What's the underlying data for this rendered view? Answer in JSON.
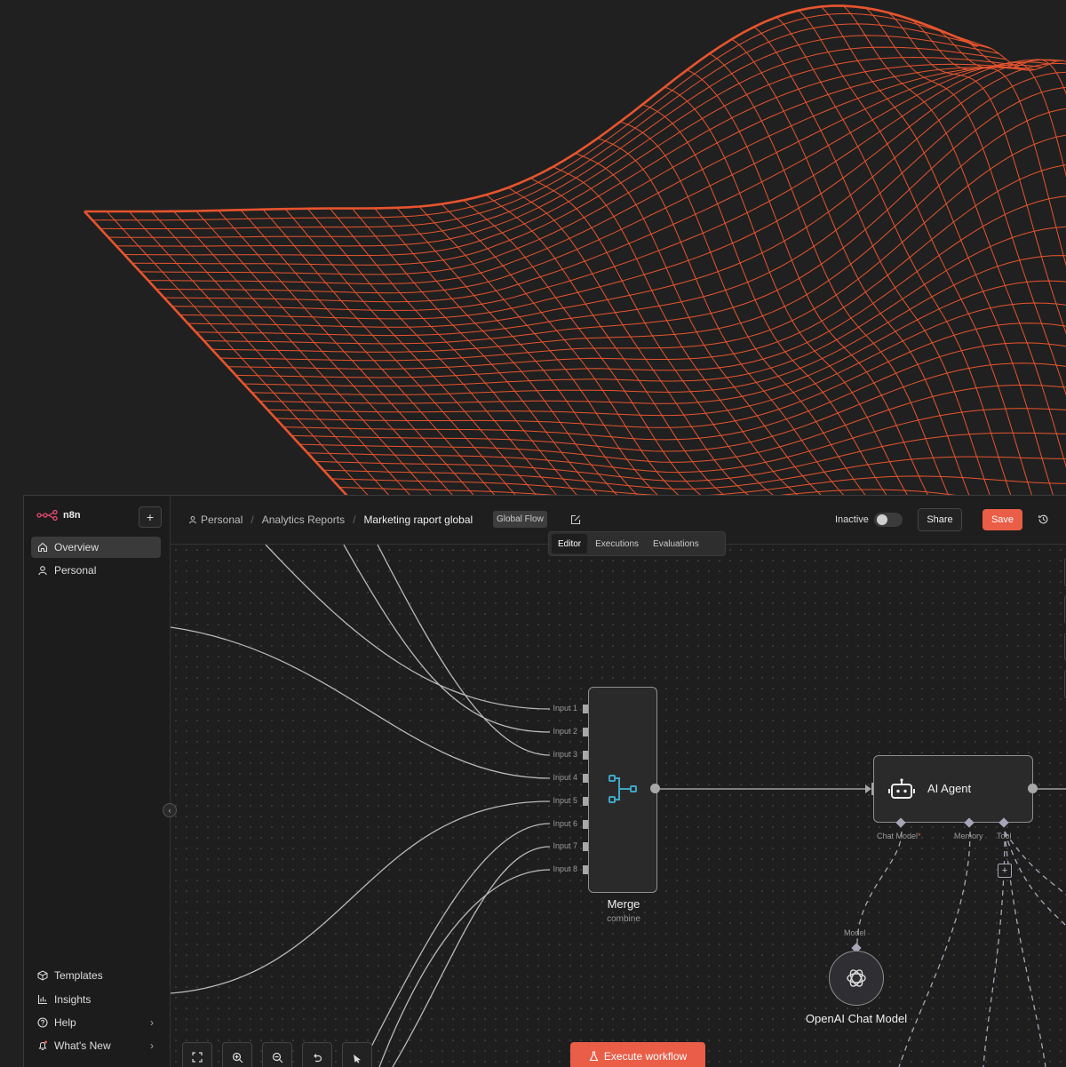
{
  "app": {
    "logo_text": "n8n",
    "new_button": "+"
  },
  "sidebar": {
    "items": [
      {
        "label": "Overview",
        "icon": "home-icon",
        "active": true
      },
      {
        "label": "Personal",
        "icon": "user-icon",
        "active": false
      }
    ],
    "bottom_items": [
      {
        "label": "Templates",
        "icon": "box-icon"
      },
      {
        "label": "Insights",
        "icon": "chart-icon"
      },
      {
        "label": "Help",
        "icon": "help-icon",
        "chevron": "›"
      },
      {
        "label": "What's New",
        "icon": "bell-icon",
        "chevron": "›"
      }
    ],
    "collapse_glyph": "‹"
  },
  "header": {
    "breadcrumbs": [
      "Personal",
      "Analytics Reports",
      "Marketing raport global"
    ],
    "separator": "/",
    "tag": "Global Flow",
    "status_label": "Inactive",
    "active": false,
    "share_label": "Share",
    "save_label": "Save",
    "tabs": [
      {
        "label": "Editor",
        "active": true
      },
      {
        "label": "Executions",
        "active": false
      },
      {
        "label": "Evaluations",
        "active": false
      }
    ]
  },
  "nodes": {
    "merge": {
      "title": "Merge",
      "subtitle": "combine",
      "inputs": [
        "Input 1",
        "Input 2",
        "Input 3",
        "Input 4",
        "Input 5",
        "Input 6",
        "Input 7",
        "Input 8"
      ]
    },
    "agent": {
      "title": "AI Agent",
      "ports": [
        {
          "label": "Chat Model",
          "required": true,
          "marker": "*"
        },
        {
          "label": "Memory",
          "required": false
        },
        {
          "label": "Tool",
          "required": false
        }
      ],
      "add_glyph": "+"
    },
    "openai": {
      "title": "OpenAI Chat Model",
      "port_label": "Model"
    }
  },
  "toolbar": {
    "execute_label": "Execute workflow",
    "controls": [
      "fit-view-icon",
      "zoom-in-icon",
      "zoom-out-icon",
      "undo-icon",
      "tidy-up-icon"
    ]
  },
  "colors": {
    "accent": "#ea5d47",
    "wireframe": "#e8542e",
    "background": "#202020",
    "merge_icon": "#3fa7c6",
    "logo": "#ea4b71"
  }
}
